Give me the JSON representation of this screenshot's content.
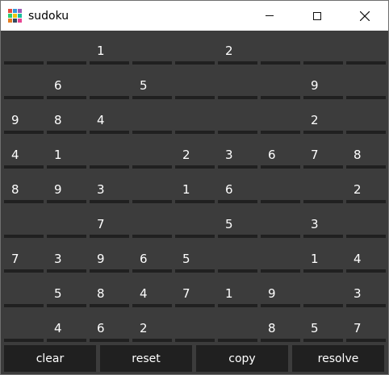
{
  "window": {
    "title": "sudoku",
    "icon_colors": [
      "#e74c3c",
      "#3498db",
      "#9b59b6",
      "#2ecc71",
      "#f1c40f",
      "#1abc9c",
      "#e67e22",
      "#34495e",
      "#e84393"
    ]
  },
  "grid": [
    [
      "",
      "",
      "1",
      "",
      "",
      "2",
      "",
      "",
      ""
    ],
    [
      "",
      "6",
      "",
      "5",
      "",
      "",
      "",
      "9",
      ""
    ],
    [
      "9",
      "8",
      "4",
      "",
      "",
      "",
      "",
      "2",
      ""
    ],
    [
      "4",
      "1",
      "",
      "",
      "2",
      "3",
      "6",
      "7",
      "8"
    ],
    [
      "8",
      "9",
      "3",
      "",
      "1",
      "6",
      "",
      "",
      "2"
    ],
    [
      "",
      "",
      "7",
      "",
      "",
      "5",
      "",
      "3",
      ""
    ],
    [
      "7",
      "3",
      "9",
      "6",
      "5",
      "",
      "",
      "1",
      "4"
    ],
    [
      "",
      "5",
      "8",
      "4",
      "7",
      "1",
      "9",
      "",
      "3"
    ],
    [
      "",
      "4",
      "6",
      "2",
      "",
      "",
      "8",
      "5",
      "7"
    ]
  ],
  "buttons": {
    "clear": "clear",
    "reset": "reset",
    "copy": "copy",
    "resolve": "resolve"
  }
}
